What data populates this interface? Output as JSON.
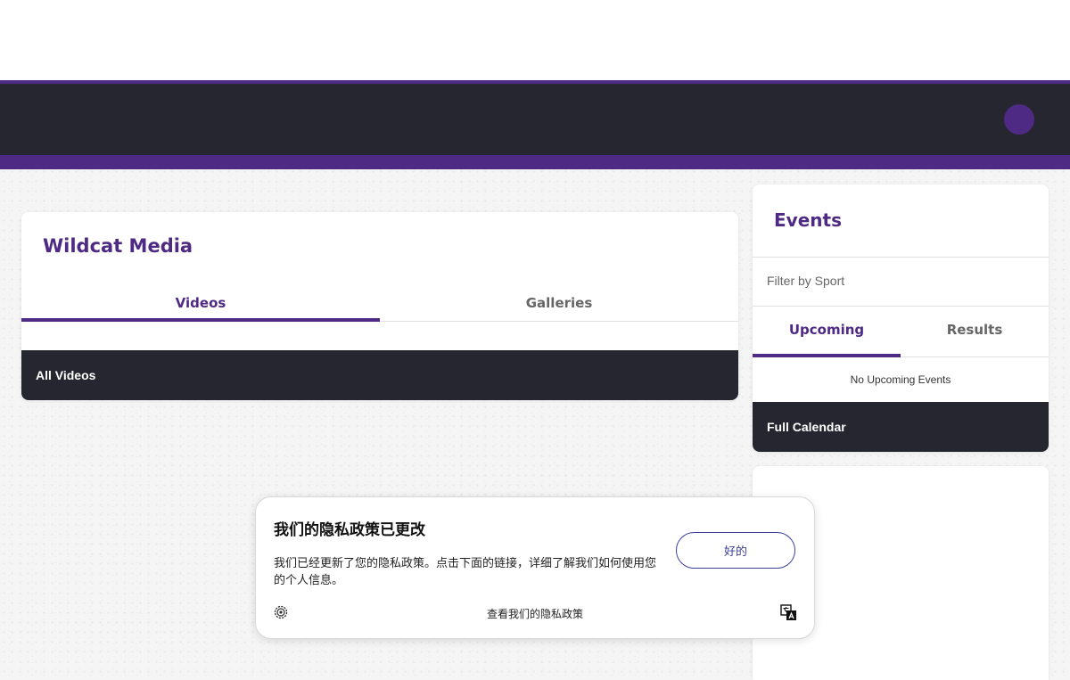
{
  "media": {
    "title": "Wildcat Media",
    "tabs": [
      {
        "label": "Videos",
        "active": true
      },
      {
        "label": "Galleries",
        "active": false
      }
    ],
    "bar_label": "All Videos"
  },
  "events": {
    "title": "Events",
    "filter_label": "Filter by Sport",
    "tabs": [
      {
        "label": "Upcoming",
        "active": true
      },
      {
        "label": "Results",
        "active": false
      }
    ],
    "empty_text": "No Upcoming Events",
    "calendar_label": "Full Calendar"
  },
  "privacy": {
    "title": "我们的隐私政策已更改",
    "body": "我们已经更新了您的隐私政策。点击下面的链接，详细了解我们如何使用您的个人信息。",
    "ok_label": "好的",
    "link_label": "查看我们的隐私政策",
    "icons": [
      "settings-icon",
      "translate-icon"
    ]
  },
  "colors": {
    "brand_purple": "#4e2a84",
    "dark": "#25262f",
    "button_blue": "#3b3f9c"
  }
}
